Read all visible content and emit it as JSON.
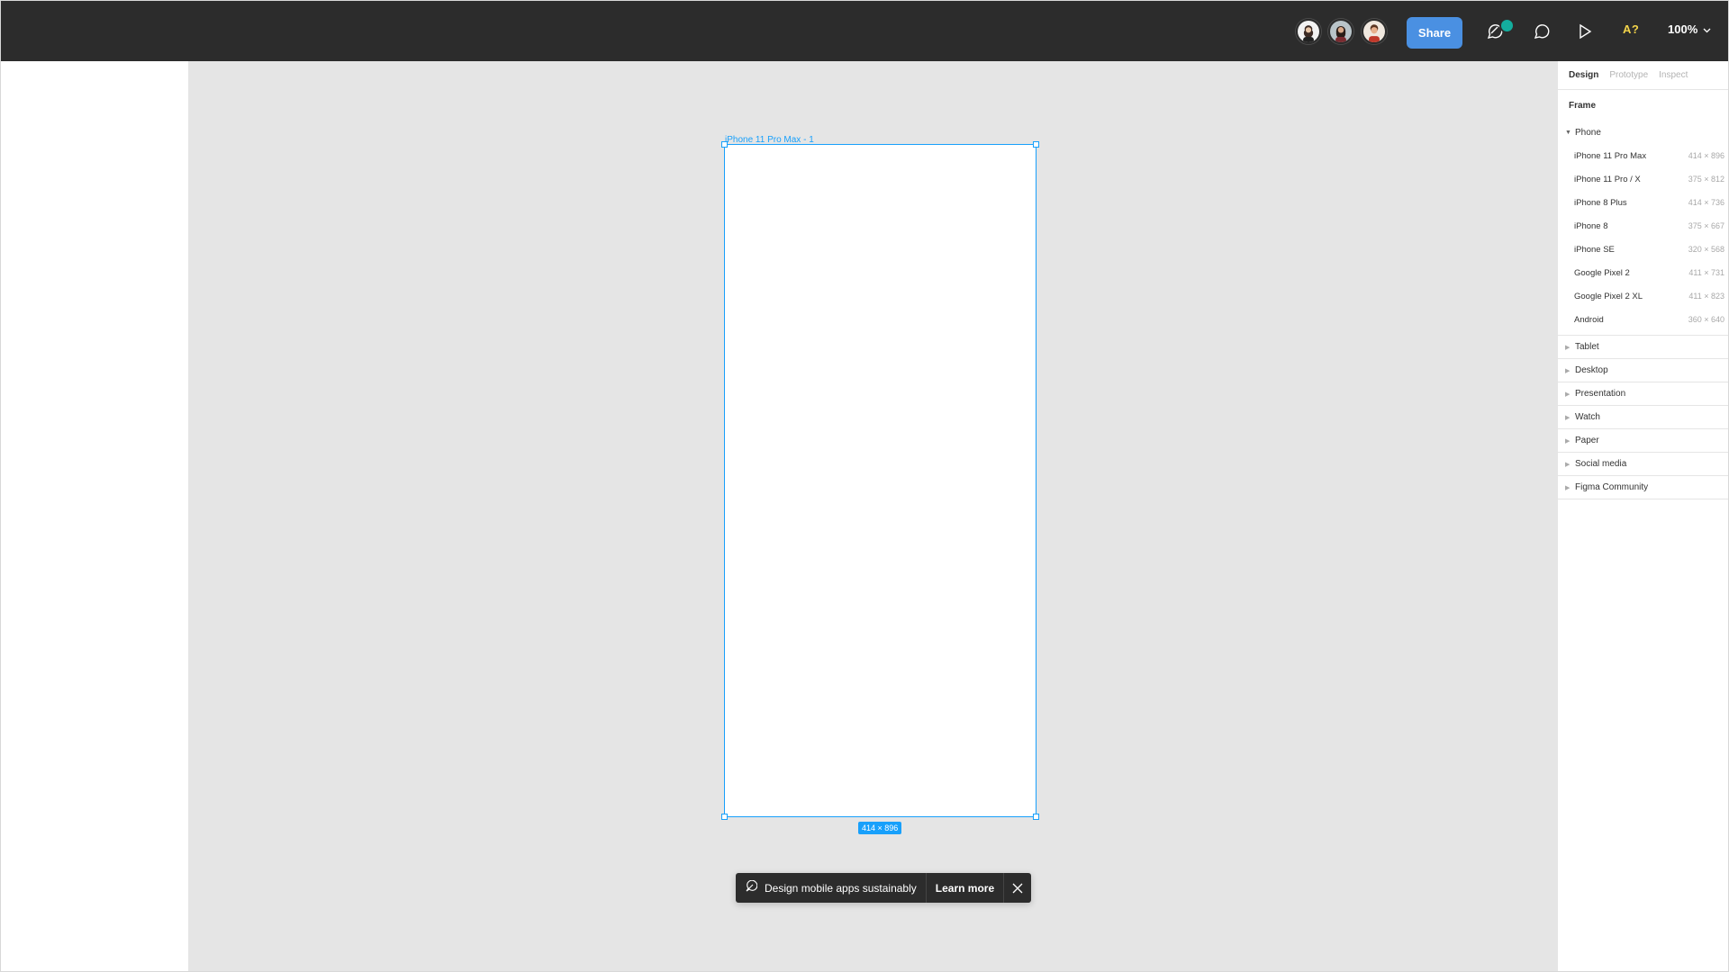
{
  "toolbar": {
    "share_label": "Share",
    "font_warning": "A?",
    "zoom_level": "100%",
    "avatars": [
      "user-avatar-1",
      "user-avatar-2",
      "user-avatar-3"
    ],
    "icons": [
      "comment-plus-icon",
      "comment-icon",
      "play-icon",
      "chevron-down-icon"
    ],
    "presence_color": "#14ae9e",
    "share_color": "#4a90e2"
  },
  "canvas": {
    "frame_label": "iPhone 11 Pro Max - 1",
    "frame_size": "414 × 896",
    "accent": "#18a0fb"
  },
  "toast": {
    "message": "Design mobile apps sustainably",
    "action": "Learn more"
  },
  "right_panel": {
    "tabs": [
      {
        "label": "Design",
        "active": true
      },
      {
        "label": "Prototype",
        "active": false
      },
      {
        "label": "Inspect",
        "active": false
      }
    ],
    "section_title": "Frame",
    "expanded_category": "Phone",
    "presets": [
      {
        "name": "iPhone 11 Pro Max",
        "size": "414 × 896"
      },
      {
        "name": "iPhone 11 Pro / X",
        "size": "375 × 812"
      },
      {
        "name": "iPhone 8 Plus",
        "size": "414 × 736"
      },
      {
        "name": "iPhone 8",
        "size": "375 × 667"
      },
      {
        "name": "iPhone SE",
        "size": "320 × 568"
      },
      {
        "name": "Google Pixel 2",
        "size": "411 × 731"
      },
      {
        "name": "Google Pixel 2 XL",
        "size": "411 × 823"
      },
      {
        "name": "Android",
        "size": "360 × 640"
      }
    ],
    "categories": [
      "Tablet",
      "Desktop",
      "Presentation",
      "Watch",
      "Paper",
      "Social media",
      "Figma Community"
    ]
  }
}
